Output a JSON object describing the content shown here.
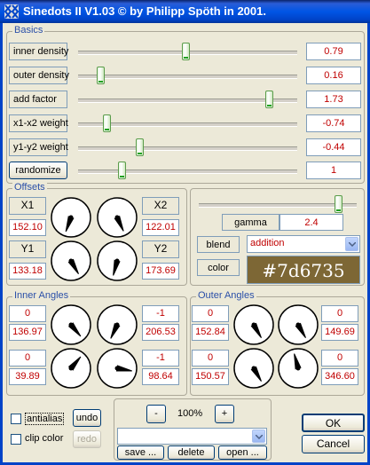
{
  "window": {
    "title": "Sinedots II V1.03 © by Philipp Spöth in 2001."
  },
  "groups": {
    "basics": "Basics",
    "offsets": "Offsets",
    "inner_angles": "Inner Angles",
    "outer_angles": "Outer Angles"
  },
  "basics": {
    "rows": [
      {
        "label": "inner density",
        "value": "0.79",
        "slider": 0.49
      },
      {
        "label": "outer density",
        "value": "0.16",
        "slider": 0.1
      },
      {
        "label": "add factor",
        "value": "1.73",
        "slider": 0.87
      },
      {
        "label": "x1-x2 weight",
        "value": "-0.74",
        "slider": 0.13
      },
      {
        "label": "y1-y2 weight",
        "value": "-0.44",
        "slider": 0.28
      },
      {
        "label": "randomize",
        "value": "1",
        "slider": 0.2
      }
    ]
  },
  "offsets": {
    "x1": {
      "label": "X1",
      "value": "152.10"
    },
    "x2": {
      "label": "X2",
      "value": "122.01"
    },
    "y1": {
      "label": "Y1",
      "value": "133.18"
    },
    "y2": {
      "label": "Y2",
      "value": "173.69"
    }
  },
  "gamma": {
    "label": "gamma",
    "value": "2.4",
    "slider": 0.88
  },
  "blend": {
    "label": "blend",
    "value": "addition"
  },
  "color": {
    "label": "color",
    "value": "#7d6735",
    "hex": "#7d6735"
  },
  "inner_angles": {
    "left": [
      {
        "top": "0",
        "bottom": "136.97"
      },
      {
        "top": "0",
        "bottom": "39.89"
      }
    ],
    "right": [
      {
        "top": "-1",
        "bottom": "206.53"
      },
      {
        "top": "-1",
        "bottom": "98.64"
      }
    ]
  },
  "outer_angles": {
    "left": [
      {
        "top": "0",
        "bottom": "152.84"
      },
      {
        "top": "0",
        "bottom": "150.57"
      }
    ],
    "right": [
      {
        "top": "0",
        "bottom": "149.69"
      },
      {
        "top": "0",
        "bottom": "346.60"
      }
    ]
  },
  "bottom": {
    "antialias": "antialias",
    "clip_color": "clip color",
    "undo": "undo",
    "redo": "redo",
    "zoom_out": "-",
    "zoom": "100%",
    "zoom_in": "+",
    "save": "save ...",
    "delete": "delete",
    "open": "open ...",
    "ok": "OK",
    "cancel": "Cancel"
  }
}
